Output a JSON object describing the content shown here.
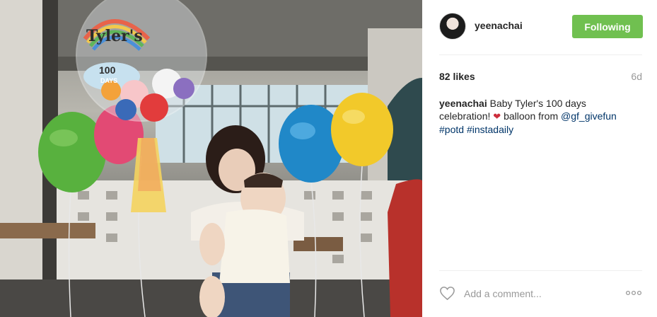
{
  "post": {
    "author": {
      "username": "yeenachai",
      "follow_label": "Following"
    },
    "likes": "82 likes",
    "age": "6d",
    "caption": {
      "author": "yeenachai",
      "text_before": "Baby Tyler's 100 days celebration!",
      "emoji": "❤",
      "text_after": "balloon from",
      "mention": "@gf_givefun",
      "tags": [
        "#potd",
        "#instadaily"
      ]
    },
    "comment": {
      "placeholder": "Add a comment..."
    }
  },
  "photo": {
    "balloon_text_1": "Tyler's",
    "balloon_text_2": "100",
    "balloon_text_3": "DAYS"
  },
  "colors": {
    "follow_button": "#70c050",
    "link": "#003569",
    "muted": "#999999"
  }
}
